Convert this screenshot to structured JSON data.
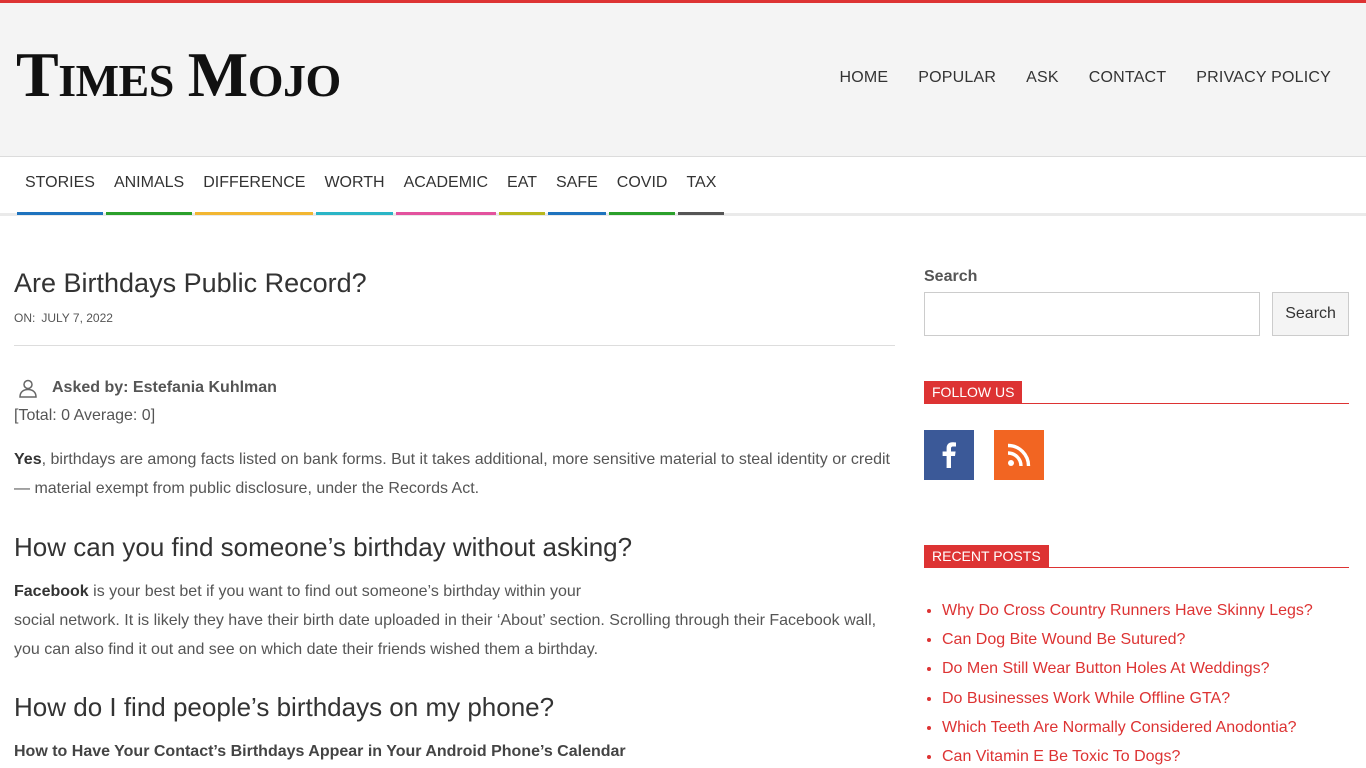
{
  "site": {
    "logo_word1_initial": "T",
    "logo_word1_rest": "IMES",
    "logo_word2_initial": "M",
    "logo_word2_rest": "OJO"
  },
  "top_nav": [
    "HOME",
    "POPULAR",
    "ASK",
    "CONTACT",
    "PRIVACY POLICY"
  ],
  "categories": [
    {
      "label": "STORIES",
      "color": "#1e73be"
    },
    {
      "label": "ANIMALS",
      "color": "#2ba02b"
    },
    {
      "label": "DIFFERENCE",
      "color": "#f2b631"
    },
    {
      "label": "WORTH",
      "color": "#2ab5c6"
    },
    {
      "label": "ACADEMIC",
      "color": "#e3529e"
    },
    {
      "label": "EAT",
      "color": "#b8b81e"
    },
    {
      "label": "SAFE",
      "color": "#1e73be"
    },
    {
      "label": "COVID",
      "color": "#2ba02b"
    },
    {
      "label": "TAX",
      "color": "#555555"
    }
  ],
  "article": {
    "title": "Are Birthdays Public Record?",
    "meta_label": "ON:",
    "date": "JULY 7, 2022",
    "asked_by": "Asked by: Estefania Kuhlman",
    "rating": "[Total: 0 Average: 0]",
    "p1_bold": "Yes",
    "p1_rest": ", birthdays are among facts listed on bank forms. But it takes additional, more sensitive material to steal identity or credit — material exempt from public disclosure, under the Records Act.",
    "h2_1": "How can you find someone’s birthday without asking?",
    "p2_bold": "Facebook",
    "p2_line1": " is your best bet if you want to find out someone’s birthday within your",
    "p2_rest": "social network. It is likely they have their birth date uploaded in their ‘About’ section. Scrolling through their Facebook wall, you can also find it out and see on which date their friends wished them a birthday.",
    "h2_2": "How do I find people’s birthdays on my phone?",
    "p3": "How to Have Your Contact’s Birthdays Appear in Your Android Phone’s Calendar"
  },
  "sidebar": {
    "search_label": "Search",
    "search_button": "Search",
    "follow_title": "FOLLOW US",
    "social": [
      {
        "name": "facebook-icon",
        "color": "#3b5998"
      },
      {
        "name": "rss-icon",
        "color": "#f26522"
      }
    ],
    "recent_title": "RECENT POSTS",
    "recent_posts": [
      "Why Do Cross Country Runners Have Skinny Legs?",
      "Can Dog Bite Wound Be Sutured?",
      "Do Men Still Wear Button Holes At Weddings?",
      "Do Businesses Work While Offline GTA?",
      "Which Teeth Are Normally Considered Anodontia?",
      "Can Vitamin E Be Toxic To Dogs?"
    ]
  },
  "colors": {
    "accent": "#dd3333",
    "header_bg": "#f4f4f4"
  }
}
